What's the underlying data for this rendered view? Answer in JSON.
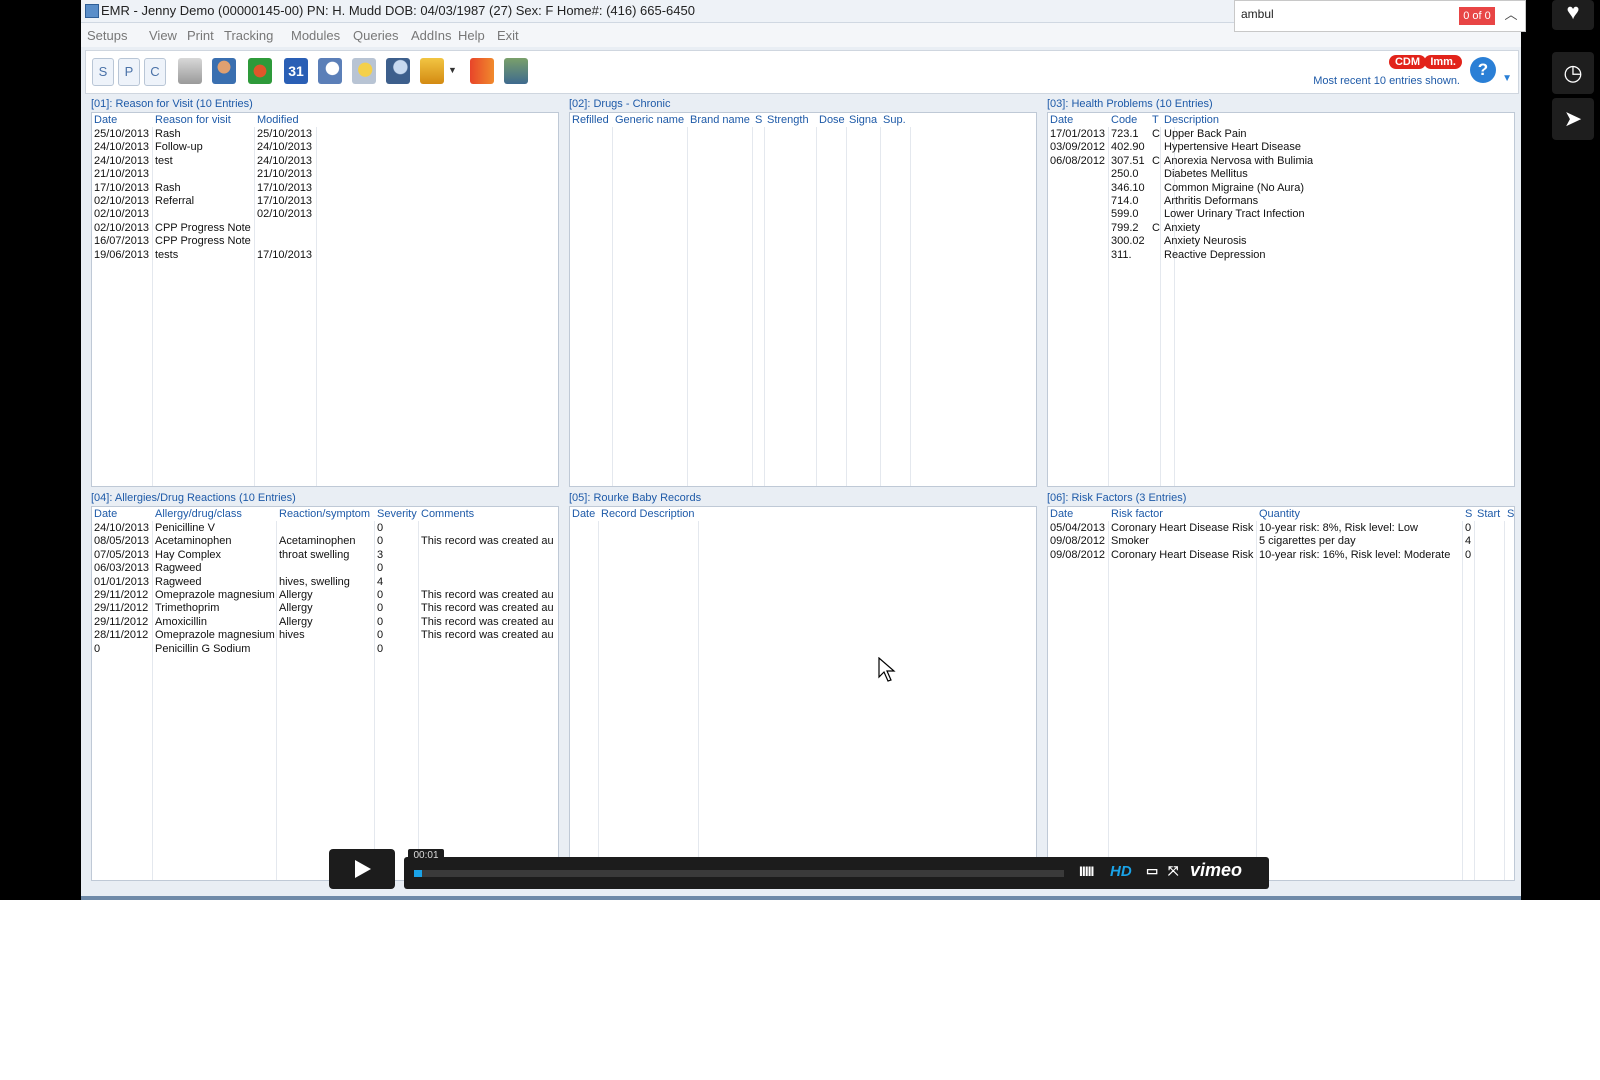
{
  "window": {
    "title": "EMR - Jenny Demo (00000145-00)    PN: H. Mudd    DOB: 04/03/1987 (27)    Sex: F    Home#: (416) 665-6450"
  },
  "menu": [
    "Setups",
    "View",
    "Print",
    "Tracking",
    "Modules",
    "Queries",
    "AddIns",
    "Help",
    "Exit"
  ],
  "toolbar": {
    "letters": [
      "S",
      "P",
      "C"
    ],
    "badges": [
      "CDM",
      "Imm."
    ],
    "recent_note": "Most recent 10 entries shown.",
    "help": "?",
    "calendar_day": "31"
  },
  "find": {
    "value": "ambul",
    "count": "0 of 0"
  },
  "panels": {
    "p01": {
      "title": "[01]: Reason for Visit (10 Entries)",
      "columns": [
        "Date",
        "Reason for visit",
        "Modified"
      ],
      "rows": [
        [
          "25/10/2013",
          "Rash",
          "25/10/2013"
        ],
        [
          "24/10/2013",
          "Follow-up",
          "24/10/2013"
        ],
        [
          "24/10/2013",
          "test",
          "24/10/2013"
        ],
        [
          "21/10/2013",
          "",
          "21/10/2013"
        ],
        [
          "17/10/2013",
          "Rash",
          "17/10/2013"
        ],
        [
          "02/10/2013",
          "Referral",
          "17/10/2013"
        ],
        [
          "02/10/2013",
          "",
          "02/10/2013"
        ],
        [
          "02/10/2013",
          "CPP Progress Note",
          ""
        ],
        [
          "16/07/2013",
          "CPP Progress Note",
          ""
        ],
        [
          "19/06/2013",
          "tests",
          "17/10/2013"
        ]
      ]
    },
    "p02": {
      "title": "[02]: Drugs - Chronic",
      "columns": [
        "Refilled",
        "Generic name",
        "Brand name",
        "S",
        "Strength",
        "Dose",
        "Signa",
        "Sup."
      ],
      "rows": []
    },
    "p03": {
      "title": "[03]: Health Problems (10 Entries)",
      "columns": [
        "Date",
        "Code",
        "T",
        "Description"
      ],
      "rows": [
        [
          "17/01/2013",
          "723.1",
          "C",
          "Upper Back Pain"
        ],
        [
          "03/09/2012",
          "402.90",
          "",
          "Hypertensive Heart Disease"
        ],
        [
          "06/08/2012",
          "307.51",
          "C",
          "Anorexia Nervosa with Bulimia"
        ],
        [
          "",
          "250.0",
          "",
          "Diabetes Mellitus"
        ],
        [
          "",
          "346.10",
          "",
          "Common Migraine (No Aura)"
        ],
        [
          "",
          "714.0",
          "",
          "Arthritis Deformans"
        ],
        [
          "",
          "599.0",
          "",
          "Lower Urinary Tract Infection"
        ],
        [
          "",
          "799.2",
          "C",
          "Anxiety"
        ],
        [
          "",
          "300.02",
          "",
          "Anxiety Neurosis"
        ],
        [
          "",
          "311.",
          "",
          "Reactive Depression"
        ]
      ]
    },
    "p04": {
      "title": "[04]: Allergies/Drug Reactions (10 Entries)",
      "columns": [
        "Date",
        "Allergy/drug/class",
        "Reaction/symptom",
        "Severity",
        "Comments"
      ],
      "rows": [
        [
          "24/10/2013",
          "Penicilline V",
          "",
          "0",
          ""
        ],
        [
          "08/05/2013",
          "Acetaminophen",
          "Acetaminophen",
          "0",
          "This record was created au"
        ],
        [
          "07/05/2013",
          "Hay Complex",
          "throat swelling",
          "3",
          ""
        ],
        [
          "06/03/2013",
          "Ragweed",
          "",
          "0",
          ""
        ],
        [
          "01/01/2013",
          "Ragweed",
          "hives, swelling",
          "4",
          ""
        ],
        [
          "29/11/2012",
          "Omeprazole magnesium",
          "Allergy",
          "0",
          "This record was created au"
        ],
        [
          "29/11/2012",
          "Trimethoprim",
          "Allergy",
          "0",
          "This record was created au"
        ],
        [
          "29/11/2012",
          "Amoxicillin",
          "Allergy",
          "0",
          "This record was created au"
        ],
        [
          "28/11/2012",
          "Omeprazole magnesium",
          "hives",
          "0",
          "This record was created au"
        ],
        [
          "0",
          "Penicillin G Sodium",
          "",
          "0",
          ""
        ]
      ]
    },
    "p05": {
      "title": "[05]: Rourke Baby Records",
      "columns": [
        "Date",
        "Record Description"
      ],
      "rows": []
    },
    "p06": {
      "title": "[06]: Risk Factors (3 Entries)",
      "columns": [
        "Date",
        "Risk factor",
        "Quantity",
        "S",
        "Start",
        "S"
      ],
      "rows": [
        [
          "05/04/2013",
          "Coronary Heart Disease Risk",
          "10-year risk: 8%, Risk level: Low",
          "0",
          "",
          ""
        ],
        [
          "09/08/2012",
          "Smoker",
          "5 cigarettes per day",
          "4",
          "",
          ""
        ],
        [
          "09/08/2012",
          "Coronary Heart Disease Risk",
          "10-year risk: 16%, Risk level: Moderate",
          "0",
          "",
          ""
        ]
      ]
    }
  },
  "player": {
    "time": "00:01",
    "hd": "HD",
    "brand": "vimeo",
    "progress_fraction": 0.01
  }
}
